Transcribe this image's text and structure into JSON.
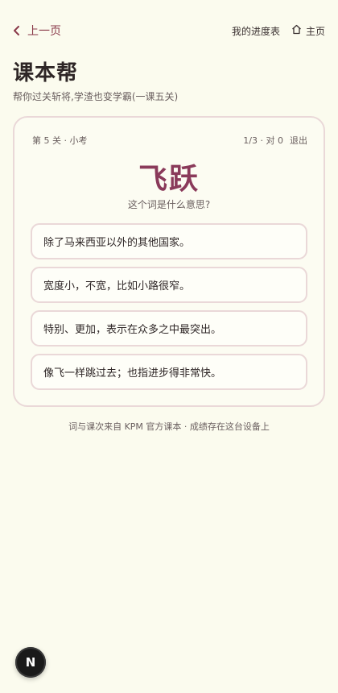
{
  "nav": {
    "back_label": "上一页",
    "progress_label": "我的进度表",
    "home_label": "主页"
  },
  "header": {
    "title": "课本帮",
    "subtitle": "帮你过关斩将,学渣也变学霸(一课五关)"
  },
  "quiz": {
    "level_label": "第 5 关 · 小考",
    "progress_text": "1/3 · 对 0",
    "exit_label": "退出",
    "word": "飞跃",
    "question": "这个词是什么意思?",
    "options": [
      "除了马来西亚以外的其他国家。",
      "宽度小，不宽，比如小路很窄。",
      "特别、更加，表示在众多之中最突出。",
      "像飞一样跳过去；也指进步得非常快。"
    ]
  },
  "footer": {
    "text": "词与课次来自 KPM 官方课本 · 成绩存在这台设备上"
  },
  "badge": {
    "letter": "N"
  },
  "colors": {
    "background": "#fbfbee",
    "accent": "#8a3a5a",
    "border": "#ead8d8"
  }
}
